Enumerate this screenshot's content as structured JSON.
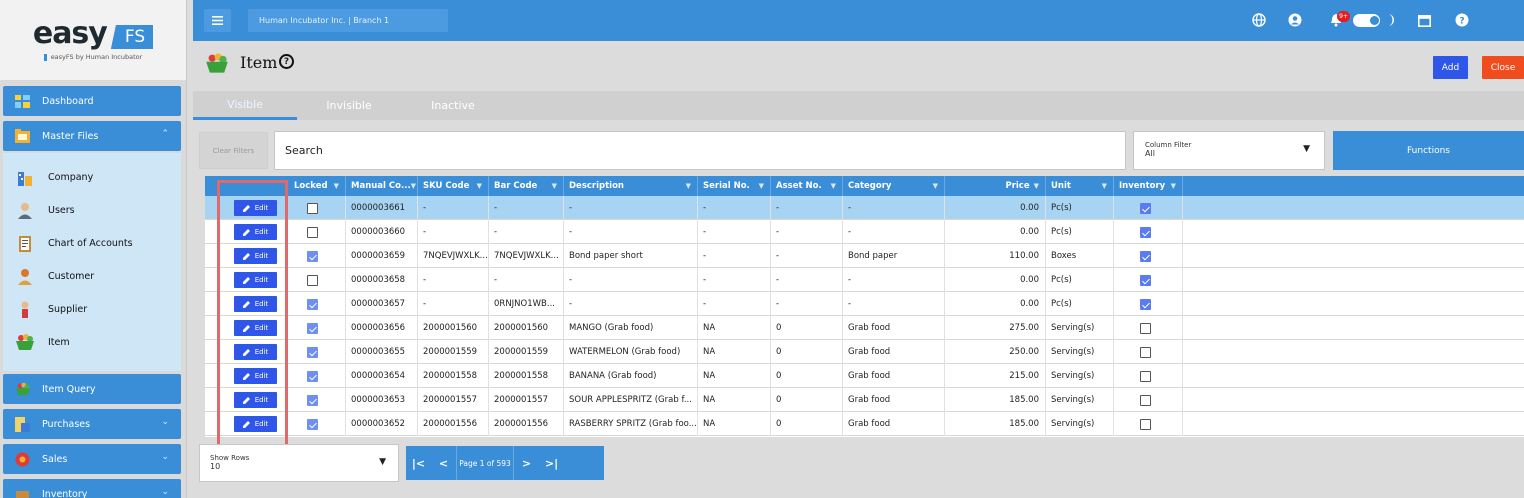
{
  "logo": {
    "easy": "easy",
    "fs": "FS",
    "sub": "easyFS by Human Incubator"
  },
  "nav": {
    "dashboard": "Dashboard",
    "master_files": "Master Files",
    "item_query": "Item Query",
    "purchases": "Purchases",
    "sales": "Sales",
    "inventory": "Inventory",
    "submenu": [
      "Company",
      "Users",
      "Chart of Accounts",
      "Customer",
      "Supplier",
      "Item"
    ]
  },
  "topbar": {
    "branch": "Human Incubator Inc. | Branch 1",
    "notif_badge": "9+"
  },
  "page": {
    "title": "Item",
    "add": "Add",
    "close": "Close"
  },
  "tabs": [
    "Visible",
    "Invisible",
    "Inactive"
  ],
  "filters": {
    "clear": "Clear Filters",
    "search_placeholder": "Search",
    "column_filter_label": "Column Filter",
    "column_filter_value": "All",
    "functions": "Functions"
  },
  "table": {
    "headers": [
      "Locked",
      "Manual Co...",
      "SKU Code",
      "Bar Code",
      "Description",
      "Serial No.",
      "Asset No.",
      "Category",
      "Price",
      "Unit",
      "Inventory"
    ],
    "edit_label": "Edit",
    "rows": [
      {
        "locked": false,
        "code": "0000003661",
        "sku": "-",
        "bar": "-",
        "desc": "-",
        "serial": "-",
        "asset": "-",
        "cat": "-",
        "price": "0.00",
        "unit": "Pc(s)",
        "inv": true
      },
      {
        "locked": false,
        "code": "0000003660",
        "sku": "-",
        "bar": "-",
        "desc": "-",
        "serial": "-",
        "asset": "-",
        "cat": "-",
        "price": "0.00",
        "unit": "Pc(s)",
        "inv": true
      },
      {
        "locked": true,
        "code": "0000003659",
        "sku": "7NQEVJWXLK...",
        "bar": "7NQEVJWXLK...",
        "desc": "Bond paper short",
        "serial": "-",
        "asset": "-",
        "cat": "Bond paper",
        "price": "110.00",
        "unit": "Boxes",
        "inv": true
      },
      {
        "locked": false,
        "code": "0000003658",
        "sku": "-",
        "bar": "-",
        "desc": "-",
        "serial": "-",
        "asset": "-",
        "cat": "-",
        "price": "0.00",
        "unit": "Pc(s)",
        "inv": true
      },
      {
        "locked": true,
        "code": "0000003657",
        "sku": "-",
        "bar": "0RNJNO1WB...",
        "desc": "-",
        "serial": "-",
        "asset": "-",
        "cat": "-",
        "price": "0.00",
        "unit": "Pc(s)",
        "inv": true
      },
      {
        "locked": true,
        "code": "0000003656",
        "sku": "2000001560",
        "bar": "2000001560",
        "desc": "MANGO (Grab food)",
        "serial": "NA",
        "asset": "0",
        "cat": "Grab food",
        "price": "275.00",
        "unit": "Serving(s)",
        "inv": false
      },
      {
        "locked": true,
        "code": "0000003655",
        "sku": "2000001559",
        "bar": "2000001559",
        "desc": "WATERMELON (Grab food)",
        "serial": "NA",
        "asset": "0",
        "cat": "Grab food",
        "price": "250.00",
        "unit": "Serving(s)",
        "inv": false
      },
      {
        "locked": true,
        "code": "0000003654",
        "sku": "2000001558",
        "bar": "2000001558",
        "desc": "BANANA (Grab food)",
        "serial": "NA",
        "asset": "0",
        "cat": "Grab food",
        "price": "215.00",
        "unit": "Serving(s)",
        "inv": false
      },
      {
        "locked": true,
        "code": "0000003653",
        "sku": "2000001557",
        "bar": "2000001557",
        "desc": "SOUR APPLESPRITZ (Grab f...",
        "serial": "NA",
        "asset": "0",
        "cat": "Grab food",
        "price": "185.00",
        "unit": "Serving(s)",
        "inv": false
      },
      {
        "locked": true,
        "code": "0000003652",
        "sku": "2000001556",
        "bar": "2000001556",
        "desc": "RASBERRY SPRITZ (Grab foo...",
        "serial": "NA",
        "asset": "0",
        "cat": "Grab food",
        "price": "185.00",
        "unit": "Serving(s)",
        "inv": false
      }
    ]
  },
  "footer": {
    "show_rows_label": "Show Rows",
    "show_rows_value": "10",
    "page_info": "Page 1 of 593"
  },
  "colors": {
    "primary": "#3a8ed8",
    "edit": "#2e56e9",
    "close": "#f14c1d",
    "selected_row": "#a7d4f3",
    "highlight": "#e06a6a"
  }
}
